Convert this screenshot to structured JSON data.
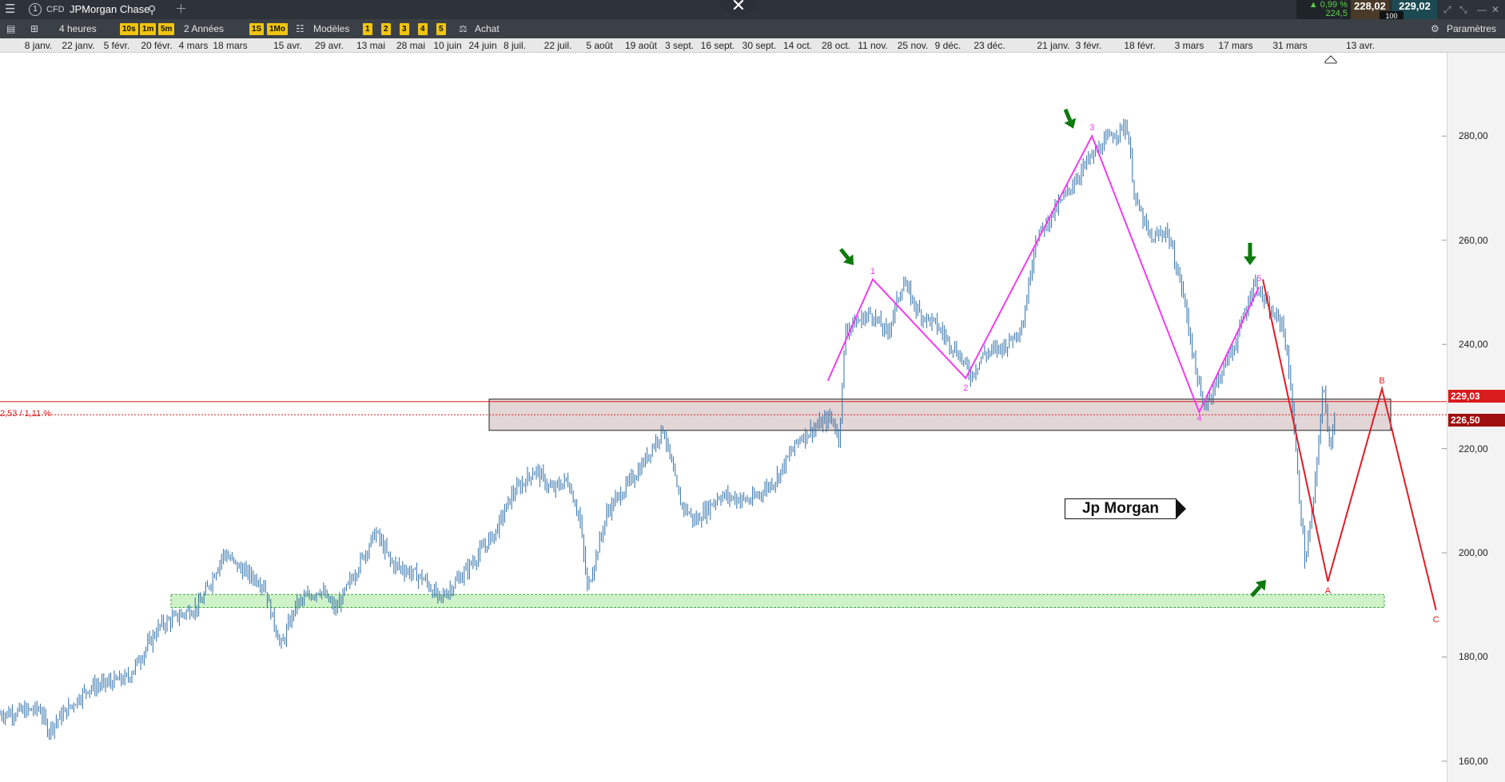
{
  "topbar": {
    "menu_icon": "hamburger-menu-icon",
    "account_number": "1",
    "instrument_type": "CFD",
    "instrument_name": "JPMorgan Chase",
    "change_pct": "▲ 0,99 %",
    "session_low": "224,5",
    "sell_price": "228,02",
    "buy_price": "229,02",
    "quantity": "100"
  },
  "toolbar": {
    "interval": "4 heures",
    "interval_buttons": [
      "10s",
      "1m",
      "5m"
    ],
    "range": "2 Années",
    "range_buttons": [
      "1S",
      "1Mo"
    ],
    "templates": "Modèles",
    "layout_buttons": [
      "1",
      "2",
      "3",
      "4",
      "5"
    ],
    "order_button": "Achat",
    "settings": "Paramètres"
  },
  "date_axis": [
    "8 janv.",
    "22 janv.",
    "5 févr.",
    "20 févr.",
    "4 mars",
    "18 mars",
    "15 avr.",
    "29 avr.",
    "13 mai",
    "28 mai",
    "10 juin",
    "24 juin",
    "8 juil.",
    "22 juil.",
    "5 août",
    "19 août",
    "3 sept.",
    "16 sept.",
    "30 sept.",
    "14 oct.",
    "28 oct.",
    "11 nov.",
    "25 nov.",
    "9 déc.",
    "23 déc.",
    "21 janv.",
    "3 févr.",
    "18 févr.",
    "3 mars",
    "17 mars",
    "31 mars",
    "13 avr."
  ],
  "price_axis_ticks": [
    "280,00",
    "260,00",
    "240,00",
    "220,00",
    "200,00",
    "180,00",
    "160,00"
  ],
  "price_labels": {
    "current": "229,03",
    "current_color": "#d81b1b",
    "reference": "226,50",
    "reference_color": "#a01010",
    "reference_change": "2,53 / 1,11 %"
  },
  "annotation": "Jp Morgan",
  "wave_labels": {
    "impulse": [
      "1",
      "2",
      "3",
      "4",
      "5"
    ],
    "correction": [
      "A",
      "B",
      "C"
    ]
  },
  "colors": {
    "candles": "#2f6fa8",
    "impulse_wave": "#f03cf0",
    "correction_wave": "#e31b23",
    "resistance_zone": "#d9c8c8",
    "support_zone": "#c8f0c0",
    "arrows": "#0e7a0e"
  },
  "chart_data": {
    "type": "candlestick",
    "instrument": "JPMorgan Chase",
    "ylim": [
      156,
      296
    ],
    "resistance_zone": [
      223.5,
      229.5
    ],
    "support_zone": [
      189.5,
      192
    ],
    "current_price": 229.03,
    "reference_price": 226.5,
    "impulse_wave": [
      {
        "label": "",
        "date": "25 oct.",
        "price": 233
      },
      {
        "label": "1",
        "date": "11 nov.",
        "price": 252.5
      },
      {
        "label": "2",
        "date": "15 déc.",
        "price": 233.5
      },
      {
        "label": "3",
        "date": "4 févr.",
        "price": 280
      },
      {
        "label": "4",
        "date": "6 mars",
        "price": 227
      },
      {
        "label": "5",
        "date": "23 mars",
        "price": 251
      }
    ],
    "correction_wave": [
      {
        "label": "",
        "date": "24 mars",
        "price": 252.5
      },
      {
        "label": "A",
        "date": "7 avr.",
        "price": 194.5
      },
      {
        "label": "B",
        "date": "17 avr.",
        "price": 231.5
      },
      {
        "label": "C",
        "date": "27 avr.",
        "price": 189
      }
    ]
  }
}
